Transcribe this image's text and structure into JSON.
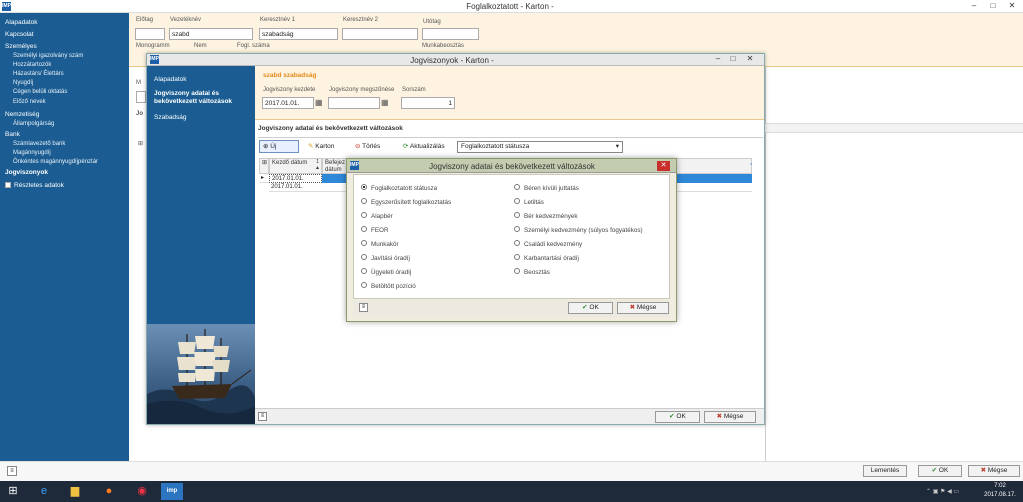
{
  "app": {
    "title": "Foglalkoztatott - Karton -",
    "icon": "IMP"
  },
  "sidebar": {
    "items": [
      {
        "label": "Alapadatok"
      },
      {
        "label": "Kapcsolat"
      },
      {
        "label": "Személyes"
      },
      {
        "label": "Személyi igazolvány szám",
        "sub": true
      },
      {
        "label": "Hozzátartozók",
        "sub": true
      },
      {
        "label": "Házastárs/ Élettárs",
        "sub": true
      },
      {
        "label": "Nyugdíj",
        "sub": true
      },
      {
        "label": "Cégen belüli oktatás",
        "sub": true
      },
      {
        "label": "Előző nevek",
        "sub": true
      },
      {
        "label": "Nemzetiség"
      },
      {
        "label": "Állampolgárság",
        "sub": true
      },
      {
        "label": "Bank"
      },
      {
        "label": "Számlavezető bank",
        "sub": true
      },
      {
        "label": "Magánnyugdíj",
        "sub": true
      },
      {
        "label": "Önkéntes magánnyugdíjpénztár",
        "sub": true
      },
      {
        "label": "Jogviszonyok",
        "bold": true
      }
    ],
    "details_checkbox": "Részletes adatok"
  },
  "topform": {
    "elotag_label": "Előtag",
    "vezeteknev_label": "Vezetéknév",
    "kereszt1_label": "Keresztnév 1",
    "kereszt2_label": "Keresztnév 2",
    "utotag_label": "Utótag",
    "vezeteknev_value": "szabd",
    "kereszt1_value": "szabadság",
    "monogram_label": "Monogramm",
    "nem_label": "Nem",
    "fogl_label": "Fogl. száma",
    "munkabeosztas_label": "Munkabeosztás"
  },
  "main": {
    "m_label": "M",
    "jo_label": "Jo"
  },
  "win2": {
    "title": "Jogviszonyok - Karton -",
    "nav": [
      "Alapadatok",
      "Jogviszony adatai és bekövetkezett változások",
      "Szabadság"
    ],
    "name": "szabd szabadság",
    "kezdete_label": "Jogviszony kezdete",
    "kezdete_value": "2017.01.01.",
    "megszunese_label": "Jogviszony megszűnése",
    "megszunese_value": "",
    "sorszam_label": "Sorszám",
    "sorszam_value": "1",
    "section_title": "Jogviszony adatai és bekövetkezett változások",
    "toolbar": {
      "new": "Új",
      "karton": "Karton",
      "delete": "Törlés",
      "update": "Aktualizálás",
      "select_value": "Foglalkoztatott státusza"
    },
    "grid": {
      "col1": "Kezdő dátum",
      "col1_sort": "1",
      "col2": "Befejez dátum",
      "rows": [
        "2017.01.01.",
        "2017.01.01."
      ]
    },
    "ok": "OK",
    "cancel": "Mégse"
  },
  "dialog": {
    "title": "Jogviszony adatai és bekövetkezett változások",
    "left": [
      "Foglalkoztatott státusza",
      "Egyszerűsített foglalkoztatás",
      "Alapbér",
      "FEOR",
      "Munkakör",
      "Javítási óradíj",
      "Ügyeleti óradíj",
      "Betöltött pozíció"
    ],
    "right": [
      "Béren kívüli juttatás",
      "Letiltás",
      "Bér kedvezmények",
      "Személyi kedvezmény (súlyos fogyatékos)",
      "Családi kedvezmény",
      "Karbantartási óradíj",
      "Beosztás"
    ],
    "selected": "Foglalkoztatott státusza",
    "ok": "OK",
    "cancel": "Mégse"
  },
  "status": {
    "save": "Lementés",
    "ok": "OK",
    "cancel": "Mégse"
  },
  "taskbar": {
    "time": "7:02",
    "date": "2017.08.17.",
    "active_app": "imp"
  },
  "colors": {
    "sidebar": "#1b5d92",
    "form_bg": "#fdf3e0",
    "dialog_title": "#c4ccb0",
    "ok_green": "#2e8b2e",
    "cancel_red": "#c0392b"
  }
}
